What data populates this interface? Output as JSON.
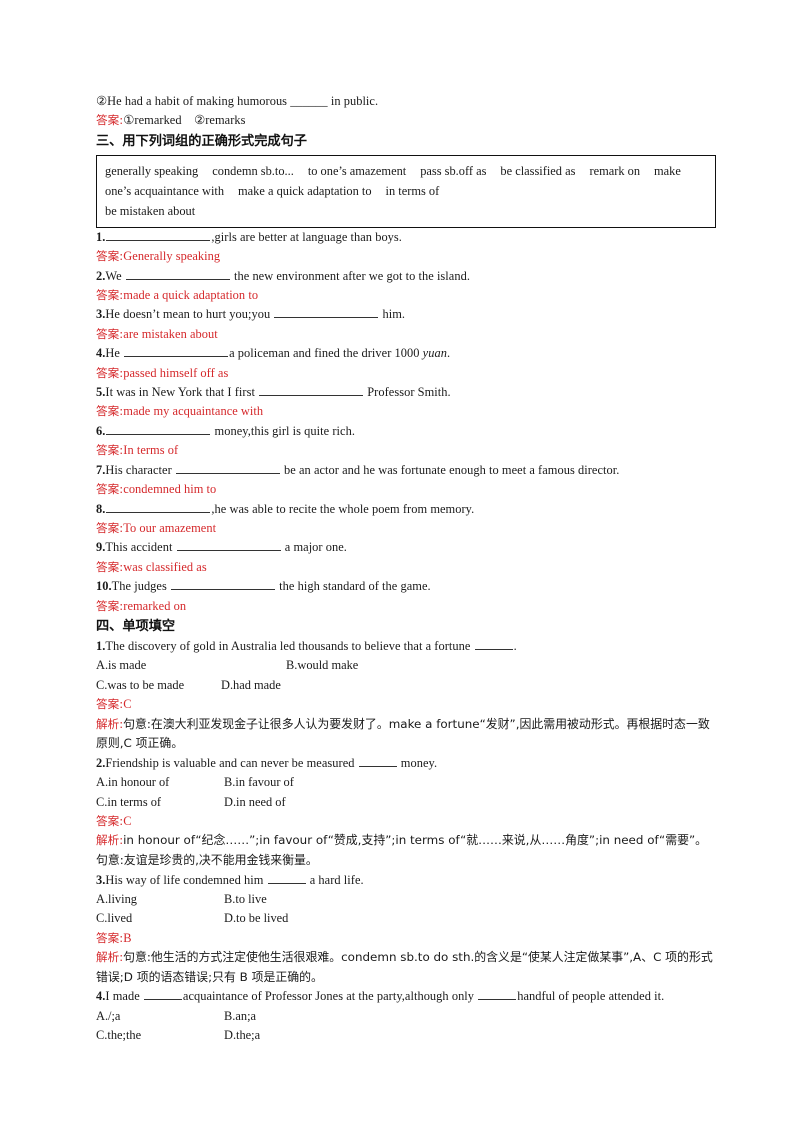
{
  "document": {
    "intro_line": "②He had a habit of making humorous ______ in public.",
    "intro_answer_label": "答案",
    "intro_answer_text": "①remarked  ②remarks"
  },
  "labels": {
    "answer": "答案",
    "analysis": "解析",
    "colon": ":"
  },
  "section3": {
    "heading": "三、用下列词组的正确形式完成句子",
    "wordbank": {
      "row1": [
        "generally speaking",
        "condemn sb.to...",
        "to one’s amazement",
        "pass sb.off as",
        "be classified as",
        "remark on",
        "make"
      ],
      "row2": [
        "one’s acquaintance with",
        "make a quick adaptation to",
        "in terms of"
      ],
      "row3": [
        "be mistaken about"
      ]
    },
    "items": [
      {
        "num": "1.",
        "pre": "",
        "blank": "md",
        "post": ",girls are better at language than boys.",
        "answer": "Generally speaking"
      },
      {
        "num": "2.",
        "pre": "We ",
        "blank": "md",
        "post": " the new environment after we got to the island.",
        "answer": "made a quick adaptation to"
      },
      {
        "num": "3.",
        "pre": "He doesn’t mean to hurt you;you ",
        "blank": "md",
        "post": " him.",
        "answer": "are mistaken about"
      },
      {
        "num": "4.",
        "pre": "He ",
        "blank": "md",
        "post": "a policeman and fined the driver 1000 ",
        "post_italic": "yuan",
        "post_tail": ".",
        "answer": "passed himself off as"
      },
      {
        "num": "5.",
        "pre": "It was in New York that I first ",
        "blank": "md",
        "post": " Professor Smith.",
        "answer": "made my acquaintance with"
      },
      {
        "num": "6.",
        "pre": "",
        "blank": "md",
        "post": " money,this girl is quite rich.",
        "answer": "In terms of"
      },
      {
        "num": "7.",
        "pre": "His character ",
        "blank": "md",
        "post": " be an actor and he was fortunate enough to meet a famous director.",
        "answer": "condemned him to"
      },
      {
        "num": "8.",
        "pre": "",
        "blank": "md",
        "post": ",he was able to recite the whole poem from memory.",
        "answer": "To our amazement"
      },
      {
        "num": "9.",
        "pre": "This accident ",
        "blank": "md",
        "post": " a major one.",
        "answer": "was classified as"
      },
      {
        "num": "10.",
        "pre": "The judges ",
        "blank": "md",
        "post": " the high standard of the game.",
        "answer": "remarked on"
      }
    ]
  },
  "section4": {
    "heading": "四、单项填空",
    "questions": [
      {
        "num": "1.",
        "stem_pre": "The discovery of gold in Australia led thousands to believe that a fortune ",
        "stem_post": ".",
        "options": [
          {
            "key": "A.",
            "text": "is made"
          },
          {
            "key": "B.",
            "text": "would make"
          },
          {
            "key": "C.",
            "text": "was to be made"
          },
          {
            "key": "D.",
            "text": "had made"
          }
        ],
        "option_layout": "wide",
        "answer": "C",
        "analysis": "句意:在澳大利亚发现金子让很多人认为要发财了。make a fortune“发财”,因此需用被动形式。再根据时态一致原则,C 项正确。"
      },
      {
        "num": "2.",
        "stem_pre": "Friendship is valuable and can never be measured ",
        "stem_post": " money.",
        "options": [
          {
            "key": "A.",
            "text": "in honour of"
          },
          {
            "key": "B.",
            "text": "in favour of"
          },
          {
            "key": "C.",
            "text": "in terms of"
          },
          {
            "key": "D.",
            "text": "in need of"
          }
        ],
        "option_layout": "grid",
        "answer": "C",
        "analysis": "in honour of“纪念……”;in favour of“赞成,支持”;in terms of“就……来说,从……角度”;in need of“需要”。句意:友谊是珍贵的,决不能用金钱来衡量。"
      },
      {
        "num": "3.",
        "stem_pre": "His way of life condemned him ",
        "stem_post": " a hard life.",
        "options": [
          {
            "key": "A.",
            "text": "living"
          },
          {
            "key": "B.",
            "text": "to live"
          },
          {
            "key": "C.",
            "text": "lived"
          },
          {
            "key": "D.",
            "text": "to be lived"
          }
        ],
        "option_layout": "grid",
        "answer": "B",
        "analysis": "句意:他生活的方式注定使他生活很艰难。condemn sb.to do sth.的含义是“使某人注定做某事”,A、C 项的形式错误;D 项的语态错误;只有 B 项是正确的。"
      },
      {
        "num": "4.",
        "stem_pre": "I made ",
        "stem_mid": "acquaintance of Professor Jones at the party,although only ",
        "stem_post": "handful of people attended it.",
        "options": [
          {
            "key": "A.",
            "text": "/;a"
          },
          {
            "key": "B.",
            "text": "an;a"
          },
          {
            "key": "C.",
            "text": "the;the"
          },
          {
            "key": "D.",
            "text": "the;a"
          }
        ],
        "option_layout": "grid",
        "answer": null,
        "analysis": null
      }
    ]
  },
  "colors": {
    "answer_red": "#d5282b",
    "text_black": "#1a1a1a",
    "box_border": "#111111",
    "page_background": "#ffffff"
  }
}
